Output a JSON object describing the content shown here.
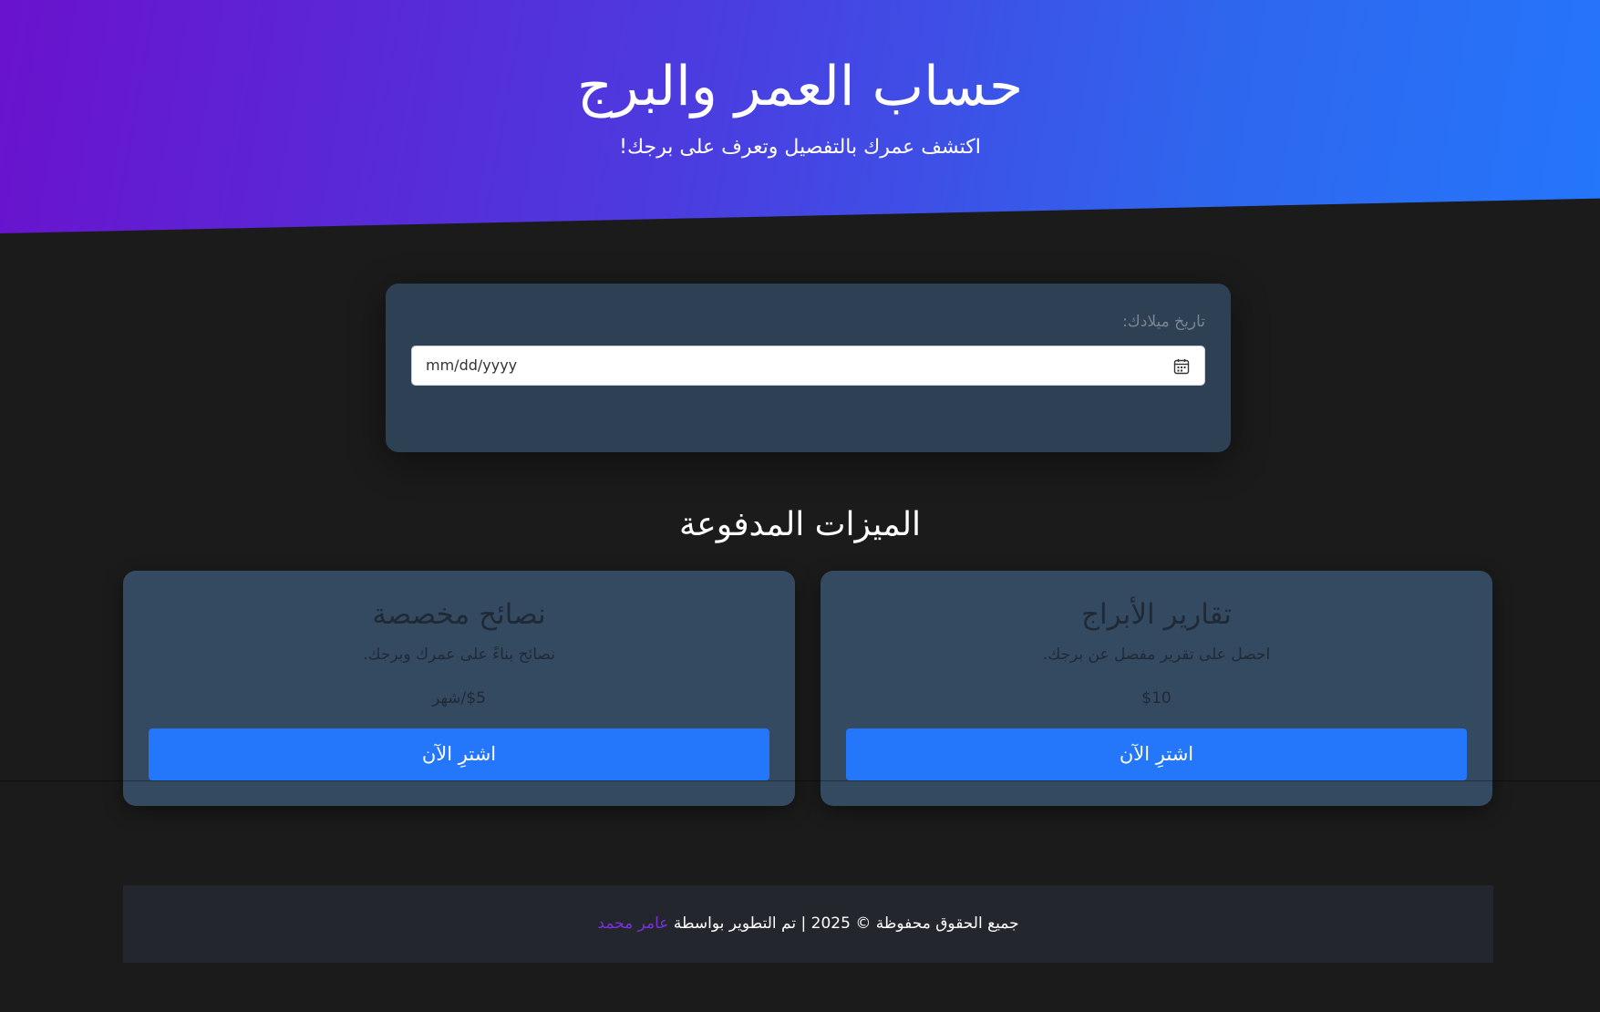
{
  "hero": {
    "title": "حساب العمر والبرج",
    "subtitle": "اكتشف عمرك بالتفصيل وتعرف على برجك!"
  },
  "birth_date": {
    "label": "تاريخ ميلادك:",
    "placeholder": "mm/dd/yyyy",
    "icon": "calendar-icon"
  },
  "paid_features": {
    "title": "الميزات المدفوعة",
    "cards": [
      {
        "title": "تقارير الأبراج",
        "description": "احصل على تقرير مفصل عن برجك.",
        "price": "$10",
        "button_label": "اشترِ الآن"
      },
      {
        "title": "نصائح مخصصة",
        "description": "نصائح بناءً على عمرك وبرجك.",
        "price": "$5/شهر",
        "button_label": "اشترِ الآن"
      }
    ]
  },
  "footer": {
    "text": "جميع الحقوق محفوظة © 2025 | تم التطوير بواسطة ",
    "author": "عامر محمد"
  },
  "colors": {
    "gradient_start": "#6a12cd",
    "gradient_end": "#2476fb",
    "background": "#1b1b1b",
    "card": "#344a61",
    "button": "#2476fb",
    "author_link": "#7b2fdc"
  }
}
